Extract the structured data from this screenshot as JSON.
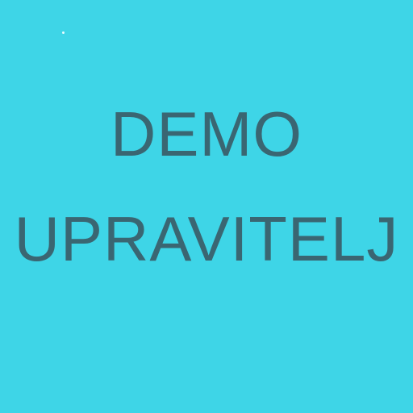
{
  "tile": {
    "background_color": "#3ed5e7",
    "text_color": "#3a6672",
    "lines": [
      "DEMO",
      "UPRAVITELJ"
    ]
  }
}
